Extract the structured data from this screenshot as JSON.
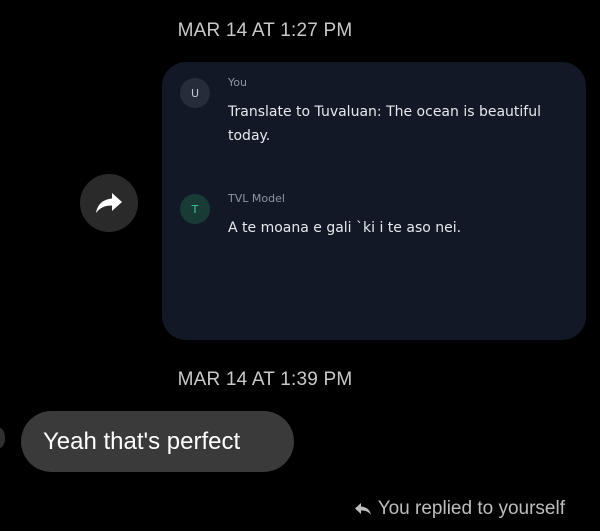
{
  "thread": {
    "timestamp_first": "MAR 14 AT 1:27 PM",
    "timestamp_second": "MAR 14 AT 1:39 PM"
  },
  "forward_button": {
    "icon": "share-arrow-icon"
  },
  "shared_card": {
    "user_message": {
      "avatar_letter": "U",
      "sender": "You",
      "text": "Translate to Tuvaluan: The ocean is beautiful today."
    },
    "model_message": {
      "avatar_letter": "T",
      "sender": "TVL Model",
      "text": "A te moana e gali `ki i te aso nei."
    }
  },
  "reply": {
    "text": "Yeah that's perfect",
    "note": "You replied to yourself",
    "note_icon": "reply-arrow-icon"
  },
  "colors": {
    "background": "#000000",
    "card": "#121826",
    "bubble": "#3a3a3a",
    "model_accent": "#41c7a2"
  }
}
